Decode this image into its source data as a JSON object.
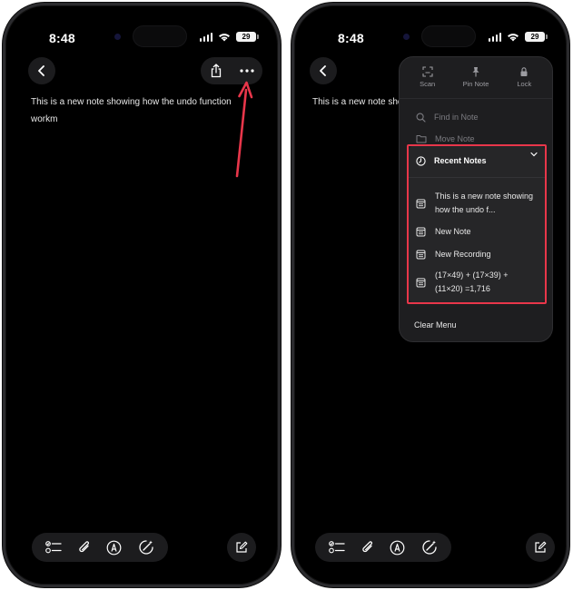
{
  "status_bar": {
    "time": "8:48",
    "battery": "29"
  },
  "note": {
    "text": "This is a new note showing how the undo function workm"
  },
  "menu": {
    "tools": [
      {
        "label": "Scan",
        "icon": "scan-icon"
      },
      {
        "label": "Pin Note",
        "icon": "pin-icon"
      },
      {
        "label": "Lock",
        "icon": "lock-icon"
      }
    ],
    "find_in_note": "Find in Note",
    "move_note": "Move Note",
    "recent_notes": {
      "title": "Recent Notes",
      "items": [
        "This is a new note showing how the undo f...",
        "New Note",
        "New Recording",
        "(17×49) + (17×39) + (11×20) =1,716"
      ]
    },
    "clear_menu": "Clear Menu"
  },
  "colors": {
    "annotation": "#e8364a",
    "background": "#000000",
    "surface": "#1c1c1e"
  }
}
